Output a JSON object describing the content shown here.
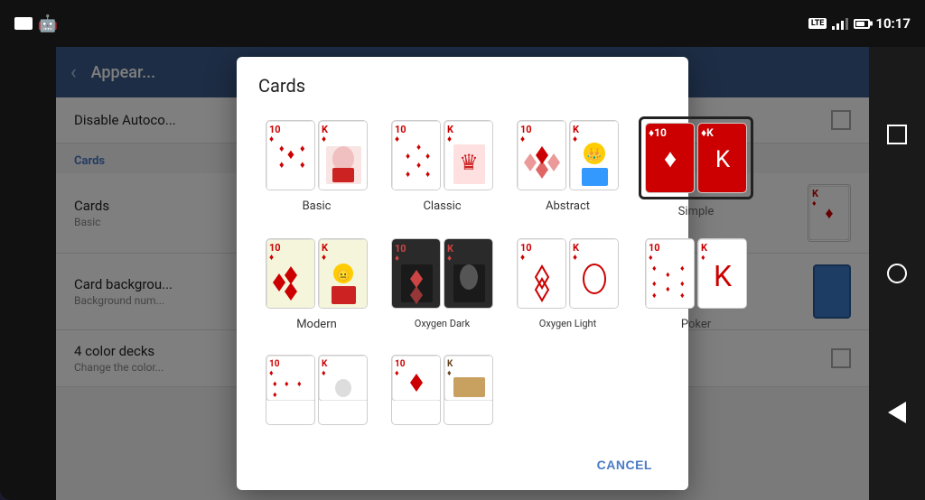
{
  "statusBar": {
    "time": "10:17",
    "lte": "LTE",
    "batteryPercent": 70
  },
  "topBar": {
    "backLabel": "‹",
    "title": "Appear..."
  },
  "settingsSections": [
    {
      "id": "disable-autocomplete",
      "title": "Disable Autoco...",
      "type": "checkbox",
      "checked": false
    }
  ],
  "sectionHeader": "Cards",
  "cardsItem": {
    "title": "Cards",
    "subtitle": "Basic"
  },
  "cardBackgroundItem": {
    "title": "Card backgrou...",
    "subtitle": "Background num..."
  },
  "fourColorItem": {
    "title": "4 color decks",
    "subtitle": "Change the color..."
  },
  "modal": {
    "title": "Cards",
    "cancelLabel": "CANCEL",
    "options": [
      {
        "id": "basic",
        "label": "Basic",
        "selected": false
      },
      {
        "id": "classic",
        "label": "Classic",
        "selected": false
      },
      {
        "id": "abstract",
        "label": "Abstract",
        "selected": false
      },
      {
        "id": "simple",
        "label": "Simple",
        "selected": true
      },
      {
        "id": "modern",
        "label": "Modern",
        "selected": false
      },
      {
        "id": "oxygen-dark",
        "label": "Oxygen Dark",
        "selected": false
      },
      {
        "id": "oxygen-light",
        "label": "Oxygen Light",
        "selected": false
      },
      {
        "id": "poker",
        "label": "Poker",
        "selected": false
      }
    ]
  },
  "navBar": {
    "square": "□",
    "circle": "○",
    "back": "◁"
  }
}
